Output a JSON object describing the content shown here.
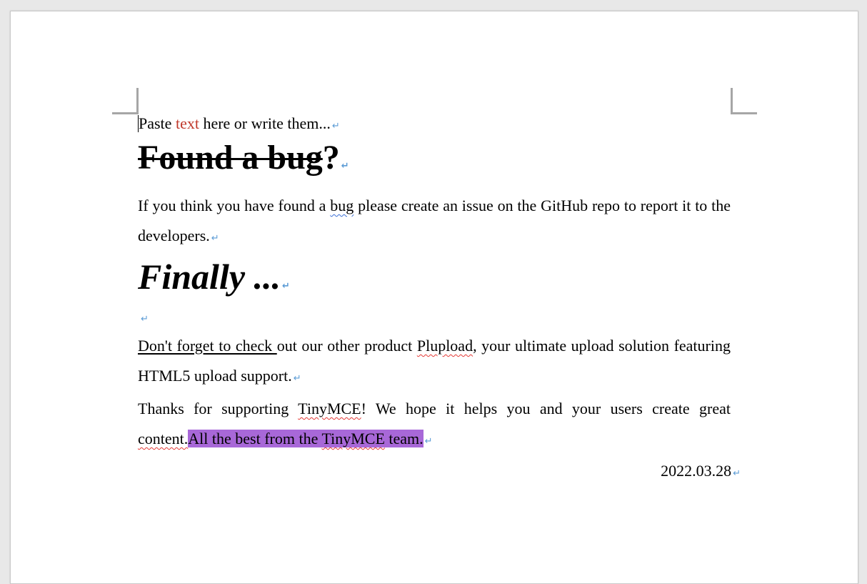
{
  "document": {
    "paragraph_mark": "↵",
    "intro": {
      "text_before": "Paste ",
      "colored_word": "text",
      "text_after": " here or write them..."
    },
    "heading1": {
      "struck_text": "Found a bug",
      "tail": "?"
    },
    "bug_paragraph": {
      "part1": "If you think you have found a ",
      "flagged_word": "bug",
      "part2": " please create an issue on the GitHub repo to report it to the developers."
    },
    "heading2": "Finally ...",
    "plupload_paragraph": {
      "underlined": "Don't forget to check ",
      "part1": "out our other product ",
      "flagged_word": "Plupload",
      "part2": ", your ultimate upload solution featuring HTML5 upload support."
    },
    "thanks_paragraph": {
      "part1": "Thanks for supporting ",
      "flagged_word1": "TinyMCE",
      "part2": "! We hope it helps you and your users create great ",
      "flagged_word2": "content.",
      "highlight_before": "All the best from the ",
      "highlight_flagged": "TinyMCE",
      "highlight_after": " team."
    },
    "date": "2022.03.28"
  },
  "colors": {
    "red_text": "#c0392b",
    "highlight": "#a868d8",
    "paragraph_mark": "#5b9bd5",
    "spellcheck_red": "#e53935",
    "grammar_blue": "#3b6fd6"
  }
}
